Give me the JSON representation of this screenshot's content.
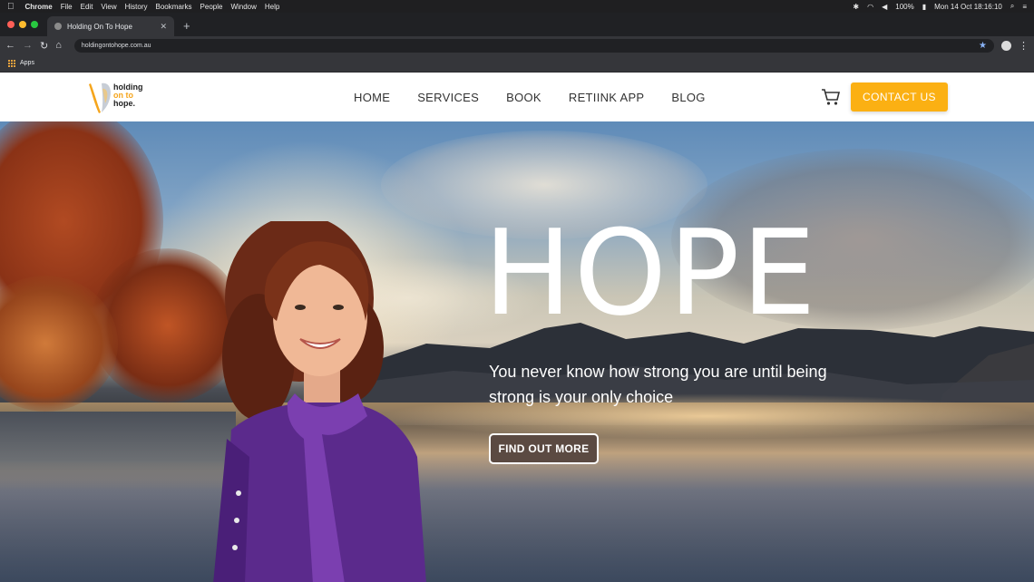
{
  "os_menubar": {
    "app_name": "Chrome",
    "menus": [
      "File",
      "Edit",
      "View",
      "History",
      "Bookmarks",
      "People",
      "Window",
      "Help"
    ],
    "battery": "100%",
    "datetime": "Mon 14 Oct  18:16:10"
  },
  "browser": {
    "tab_title": "Holding On To Hope",
    "url": "holdingontohope.com.au",
    "bookmarks_apps_label": "Apps"
  },
  "site": {
    "logo": {
      "line1": "holding",
      "line2": "on to",
      "line3": "hope."
    },
    "nav": [
      "HOME",
      "SERVICES",
      "BOOK",
      "RETIINK APP",
      "BLOG"
    ],
    "contact_label": "CONTACT US",
    "accent_color": "#fbb013"
  },
  "hero": {
    "title": "HOPE",
    "subtitle": "You never know how strong you are until being strong is your only choice",
    "cta_label": "FIND OUT MORE"
  }
}
